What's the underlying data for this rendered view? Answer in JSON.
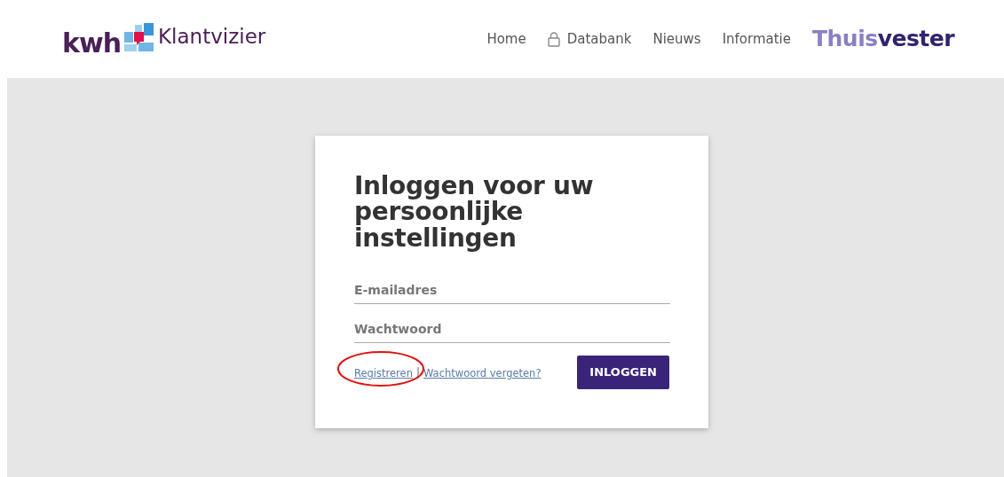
{
  "header": {
    "logo": {
      "short": "kwh",
      "name": "Klantvizier"
    },
    "nav": [
      {
        "label": "Home",
        "locked": false
      },
      {
        "label": "Databank",
        "locked": true
      },
      {
        "label": "Nieuws",
        "locked": false
      },
      {
        "label": "Informatie",
        "locked": false
      }
    ],
    "partner_logo": {
      "part_1": "Thuis",
      "part_2": "vester"
    }
  },
  "login": {
    "title": "Inloggen voor uw persoonlijke instellingen",
    "fields": [
      {
        "placeholder": "E-mailadres"
      },
      {
        "placeholder": "Wachtwoord"
      }
    ],
    "links": [
      {
        "label": "Registreren",
        "highlighted": true
      },
      {
        "label": "Wachtwoord vergeten?",
        "highlighted": false
      }
    ],
    "separator": "|",
    "button": "INLOGGEN"
  }
}
